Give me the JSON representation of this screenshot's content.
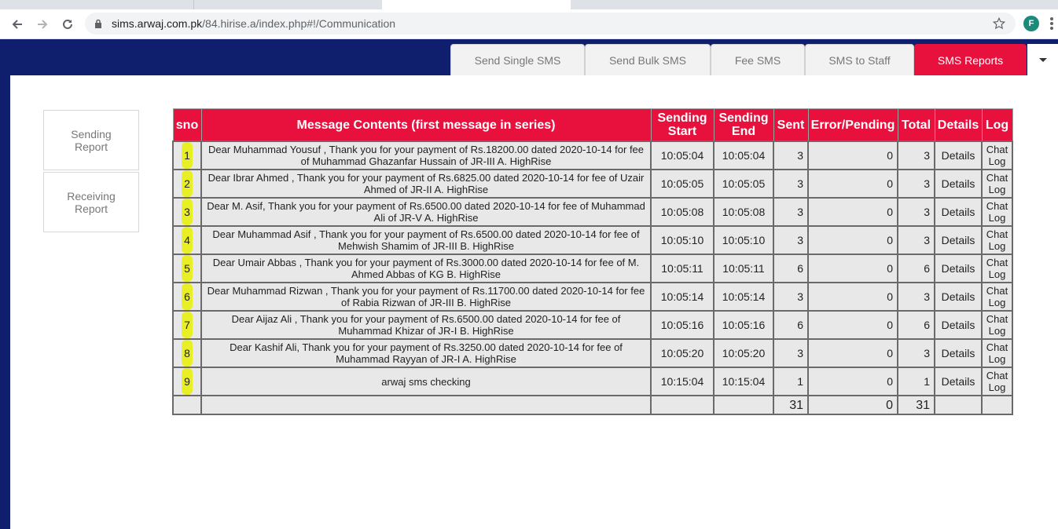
{
  "browser": {
    "url_host": "sims.arwaj.com.pk",
    "url_path": "/84.hirise.a/index.php#!/Communication",
    "profile_initial": "F"
  },
  "nav_tabs": [
    {
      "label": "Send Single SMS",
      "active": false
    },
    {
      "label": "Send Bulk SMS",
      "active": false
    },
    {
      "label": "Fee SMS",
      "active": false
    },
    {
      "label": "SMS to Staff",
      "active": false
    },
    {
      "label": "SMS Reports",
      "active": true
    }
  ],
  "side_menu": {
    "sending_line1": "Sending",
    "sending_line2": "Report",
    "receiving_line1": "Receiving",
    "receiving_line2": "Report"
  },
  "table": {
    "headers": {
      "sno": "sno",
      "message": "Message Contents (first message in series)",
      "start_line1": "Sending",
      "start_line2": "Start",
      "end_line1": "Sending",
      "end_line2": "End",
      "sent": "Sent",
      "error": "Error/Pending",
      "total": "Total",
      "details": "Details",
      "log": "Log"
    },
    "rows": [
      {
        "sno": "1",
        "message": "Dear Muhammad Yousuf , Thank you for your payment of Rs.18200.00 dated 2020-10-14 for fee of Muhammad Ghazanfar Hussain of JR-III A. HighRise",
        "start": "10:05:04",
        "end": "10:05:04",
        "sent": "3",
        "error": "0",
        "total": "3",
        "details": "Details",
        "log_line1": "Chat",
        "log_line2": "Log"
      },
      {
        "sno": "2",
        "message": "Dear Ibrar Ahmed , Thank you for your payment of Rs.6825.00 dated 2020-10-14 for fee of Uzair Ahmed of JR-II A. HighRise",
        "start": "10:05:05",
        "end": "10:05:05",
        "sent": "3",
        "error": "0",
        "total": "3",
        "details": "Details",
        "log_line1": "Chat",
        "log_line2": "Log"
      },
      {
        "sno": "3",
        "message": "Dear M. Asif, Thank you for your payment of Rs.6500.00 dated 2020-10-14 for fee of Muhammad Ali of JR-V A. HighRise",
        "start": "10:05:08",
        "end": "10:05:08",
        "sent": "3",
        "error": "0",
        "total": "3",
        "details": "Details",
        "log_line1": "Chat",
        "log_line2": "Log"
      },
      {
        "sno": "4",
        "message": "Dear Muhammad Asif , Thank you for your payment of Rs.6500.00 dated 2020-10-14 for fee of Mehwish Shamim of JR-III B. HighRise",
        "start": "10:05:10",
        "end": "10:05:10",
        "sent": "3",
        "error": "0",
        "total": "3",
        "details": "Details",
        "log_line1": "Chat",
        "log_line2": "Log"
      },
      {
        "sno": "5",
        "message": "Dear Umair Abbas , Thank you for your payment of Rs.3000.00 dated 2020-10-14 for fee of M. Ahmed Abbas of KG B. HighRise",
        "start": "10:05:11",
        "end": "10:05:11",
        "sent": "6",
        "error": "0",
        "total": "6",
        "details": "Details",
        "log_line1": "Chat",
        "log_line2": "Log"
      },
      {
        "sno": "6",
        "message": "Dear Muhammad Rizwan , Thank you for your payment of Rs.11700.00 dated 2020-10-14 for fee of Rabia Rizwan of JR-III B. HighRise",
        "start": "10:05:14",
        "end": "10:05:14",
        "sent": "3",
        "error": "0",
        "total": "3",
        "details": "Details",
        "log_line1": "Chat",
        "log_line2": "Log"
      },
      {
        "sno": "7",
        "message": "Dear Aijaz Ali , Thank you for your payment of Rs.6500.00 dated 2020-10-14 for fee of Muhammad Khizar of JR-I B. HighRise",
        "start": "10:05:16",
        "end": "10:05:16",
        "sent": "6",
        "error": "0",
        "total": "6",
        "details": "Details",
        "log_line1": "Chat",
        "log_line2": "Log"
      },
      {
        "sno": "8",
        "message": "Dear Kashif Ali, Thank you for your payment of Rs.3250.00 dated 2020-10-14 for fee of Muhammad Rayyan of JR-I A. HighRise",
        "start": "10:05:20",
        "end": "10:05:20",
        "sent": "3",
        "error": "0",
        "total": "3",
        "details": "Details",
        "log_line1": "Chat",
        "log_line2": "Log"
      },
      {
        "sno": "9",
        "message": "arwaj sms checking",
        "start": "10:15:04",
        "end": "10:15:04",
        "sent": "1",
        "error": "0",
        "total": "1",
        "details": "Details",
        "log_line1": "Chat",
        "log_line2": "Log"
      }
    ],
    "totals": {
      "sent": "31",
      "error": "0",
      "total": "31"
    }
  },
  "colors": {
    "header_blue": "#0f1f6e",
    "accent_red": "#e8103c",
    "highlight_yellow": "#e9ef1a"
  }
}
